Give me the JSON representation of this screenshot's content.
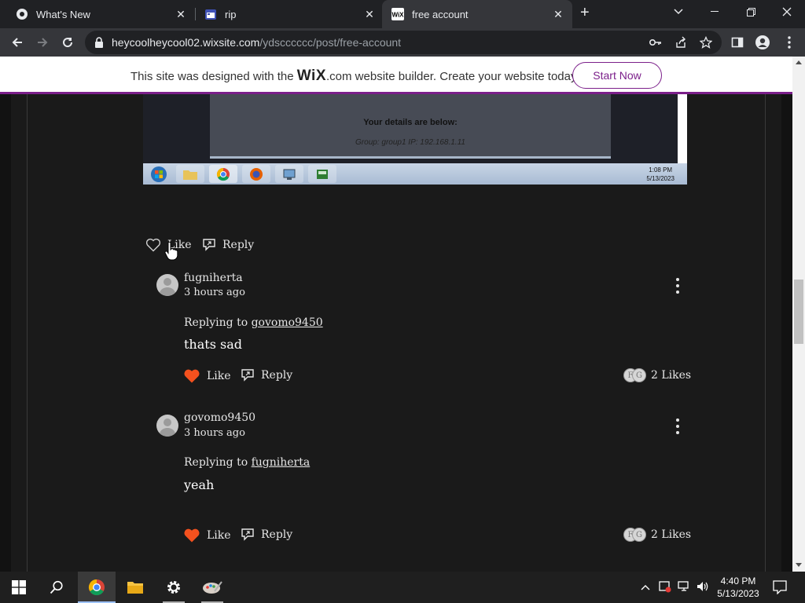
{
  "browser": {
    "tabs": [
      {
        "title": "What's New",
        "icon": "chrome-icon"
      },
      {
        "title": "rip",
        "icon": "calendar-icon"
      },
      {
        "title": "free account",
        "icon": "wix-icon",
        "active": true
      }
    ],
    "url_host": "heycoolheycool02.wixsite.com",
    "url_path": "/ydscccccc/post/free-account"
  },
  "banner": {
    "text_before": "This site was designed with the ",
    "brand": "WiX",
    "text_after": ".com website builder. Create your website today.",
    "cta": "Start Now",
    "accent": "#7b1f8a"
  },
  "embedded_screenshot": {
    "details_label": "Your details are below:",
    "group_line": "Group: group1   IP: 192.168.1.11",
    "clock_time": "1:08 PM",
    "clock_date": "5/13/2023"
  },
  "top_actions": {
    "like_label": "Like",
    "reply_label": "Reply"
  },
  "comments": [
    {
      "author": "fugniherta",
      "time": "3 hours ago",
      "replying_prefix": "Replying to ",
      "replying_to": "govomo9450",
      "text": "thats sad",
      "like_label": "Like",
      "reply_label": "Reply",
      "likes_count": "2 Likes",
      "liker_initials": [
        "F",
        "G"
      ],
      "liked": true
    },
    {
      "author": "govomo9450",
      "time": "3 hours ago",
      "replying_prefix": "Replying to ",
      "replying_to": "fugniherta",
      "text": "yeah",
      "like_label": "Like",
      "reply_label": "Reply",
      "likes_count": "2 Likes",
      "liker_initials": [
        "F",
        "G"
      ],
      "liked": true
    }
  ],
  "taskbar": {
    "time": "4:40 PM",
    "date": "5/13/2023"
  },
  "colors": {
    "heart": "#f4511e",
    "page_bg": "#1a1a1a"
  }
}
